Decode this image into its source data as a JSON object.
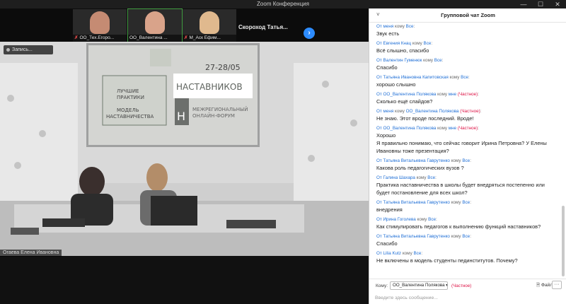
{
  "window": {
    "title": "Zoom Конференция",
    "minimize": "—",
    "maximize": "☐",
    "close": "✕"
  },
  "thumbnails": [
    {
      "name": "ОО_Тех.Егоро...",
      "active": false
    },
    {
      "name": "ОО_Валентина ...",
      "active": true
    },
    {
      "name": "М_Аск Ефим...",
      "active": false
    }
  ],
  "speaker_tile": "Скороход Татья...",
  "next_button": "›",
  "record_button": "Запись...",
  "slide": {
    "left_line1": "ЛУЧШИЕ",
    "left_line2": "ПРАКТИКИ",
    "left_line3": "МОДЕЛЬ",
    "left_line4": "НАСТАВНИЧЕСТВА",
    "right_title": "НАСТАВНИКОВ",
    "date": "27-28/05",
    "subtitle1": "МЕЖРЕГИОНАЛЬНЫЙ",
    "subtitle2": "ОНЛАЙН-ФОРУМ",
    "letter": "Н"
  },
  "active_speaker": "Огаева Елена Ивановна",
  "chat": {
    "title": "Групповой чат Zoom",
    "collapse_icon": "˅",
    "messages": [
      {
        "from": "От меня",
        "to": "Все",
        "private": "",
        "text": "Звук есть"
      },
      {
        "from": "От Евгения Кнац",
        "to": "Все",
        "private": "",
        "text": "Всё слышно, спасибо"
      },
      {
        "from": "От Валентин Гуменюк",
        "to": "Все",
        "private": "",
        "text": "Спасибо"
      },
      {
        "from": "От Татьяна Ивановна Капитовская",
        "to": "Все",
        "private": "",
        "text": "хорошо слышно"
      },
      {
        "from": "От ОО_Валентина Полякова",
        "to": "мне",
        "private": "(Частное)",
        "text": "Сколько ещё слайдов?"
      },
      {
        "from": "От меня",
        "to": "ОО_Валентина Полякова",
        "private": "(Частное)",
        "text": "Не знаю. Этот вроде последний. Вроде!"
      },
      {
        "from": "От ОО_Валентина Полякова",
        "to": "мне",
        "private": "(Частное)",
        "text": "Хорошо\nЯ правильно понимаю, что сейчас говорит Ирина Петровна? У Елены Ивановны тоже презентация?"
      },
      {
        "from": "От Татьяна Витальевна Гаврутенко",
        "to": "Все",
        "private": "",
        "text": "Какова роль педагогических вузов ?"
      },
      {
        "from": "От Галина Шахара",
        "to": "Все",
        "private": "",
        "text": "Практика наставничества в школы будет внедряться постепенно или будет постановление для всех школ?"
      },
      {
        "from": "От Татьяна Витальевна Гаврутенко",
        "to": "Все",
        "private": "",
        "text": "внедрения"
      },
      {
        "from": "От Ирина Гоголева",
        "to": "Все",
        "private": "",
        "text": "Как стимулировать педагогов к выполнению функций наставников?"
      },
      {
        "from": "От Татьяна Витальевна Гаврутенко",
        "to": "Все",
        "private": "",
        "text": "Спасибо"
      },
      {
        "from": "От Lilia Kutz",
        "to": "Все",
        "private": "",
        "text": "Не включены в модель студенты пединститутов. Почему?"
      }
    ],
    "to_word": "кому",
    "composer": {
      "to_label": "Кому:",
      "to_value": "ОО_Валентина Полякова ▾",
      "private_label": "(Частное)",
      "file_label": "Файл",
      "more_label": "···",
      "placeholder": "Введите здесь сообщение..."
    }
  }
}
